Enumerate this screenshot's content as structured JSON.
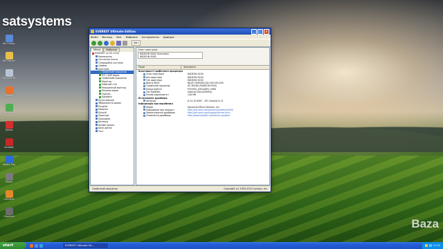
{
  "brand": "satsystems",
  "watermark": "Baza",
  "desktop_icons": [
    {
      "label": "My Computer",
      "color": "#5b8ad6"
    },
    {
      "label": "My Documents",
      "color": "#e7c04a"
    },
    {
      "label": "Recycle Bin",
      "color": "#b8c5d6"
    },
    {
      "label": "Firefox",
      "color": "#e5732b"
    },
    {
      "label": "Network",
      "color": "#4caf50"
    },
    {
      "label": "Opera",
      "color": "#d32f2f"
    },
    {
      "label": "Acrobat",
      "color": "#c62828"
    },
    {
      "label": "Media Player",
      "color": "#2b6cd6"
    },
    {
      "label": "Player",
      "color": "#7a7a7a"
    },
    {
      "label": "Uninstall",
      "color": "#e08a2b"
    },
    {
      "label": "Shortcut",
      "color": "#6d6d6d"
    }
  ],
  "window": {
    "title": "EVEREST Ultimate Edition",
    "menu": [
      "Файл",
      "Вигляд",
      "Звіт",
      "Вибране",
      "Інструменти",
      "Довідка"
    ],
    "report_button": "Звіт",
    "tabs": [
      "Меню",
      "Вибране"
    ],
    "tree": [
      {
        "label": "EVEREST v2.55.1316",
        "level": 0,
        "color": "#c0392b"
      },
      {
        "label": "Компьютер",
        "level": 1,
        "color": "#4a78c2"
      },
      {
        "label": "Системна плата",
        "level": 1,
        "color": "#4a78c2"
      },
      {
        "label": "Операційна система",
        "level": 1,
        "color": "#4a78c2"
      },
      {
        "label": "Сервер",
        "level": 1,
        "color": "#4a78c2"
      },
      {
        "label": "Дисплей",
        "level": 1,
        "color": "#4a78c2"
      },
      {
        "label": "Графічний процесор",
        "level": 2,
        "color": "#3d9a3d",
        "selected": true
      },
      {
        "label": "PCI / AGP відео",
        "level": 2,
        "color": "#3d9a3d"
      },
      {
        "label": "Графічний процесор",
        "level": 2,
        "color": "#3d9a3d"
      },
      {
        "label": "Монітор",
        "level": 2,
        "color": "#3d9a3d"
      },
      {
        "label": "Робочий стіл",
        "level": 2,
        "color": "#3d9a3d"
      },
      {
        "label": "Множинний монітор",
        "level": 2,
        "color": "#3d9a3d"
      },
      {
        "label": "Режими відео",
        "level": 2,
        "color": "#3d9a3d"
      },
      {
        "label": "OpenGL",
        "level": 2,
        "color": "#3d9a3d"
      },
      {
        "label": "Шрифти",
        "level": 2,
        "color": "#3d9a3d"
      },
      {
        "label": "Мультимедіа",
        "level": 1,
        "color": "#4a78c2"
      },
      {
        "label": "Збереження даних",
        "level": 1,
        "color": "#4a78c2"
      },
      {
        "label": "Розділи",
        "level": 1,
        "color": "#4a78c2"
      },
      {
        "label": "Мережа",
        "level": 1,
        "color": "#4a78c2"
      },
      {
        "label": "DirectX",
        "level": 1,
        "color": "#4a78c2"
      },
      {
        "label": "Пристрої",
        "level": 1,
        "color": "#4a78c2"
      },
      {
        "label": "Програми",
        "level": 1,
        "color": "#4a78c2"
      },
      {
        "label": "Безпека",
        "level": 1,
        "color": "#4a78c2"
      },
      {
        "label": "Конфігурація",
        "level": 1,
        "color": "#4a78c2"
      },
      {
        "label": "База даних",
        "level": 1,
        "color": "#4a78c2"
      },
      {
        "label": "Тест",
        "level": 1,
        "color": "#4a78c2"
      }
    ],
    "device_box_label": "Опис пристрою",
    "devices": [
      "RADEON 9200 Secondary",
      "RADEON 9200"
    ],
    "columns": [
      "Поле",
      "Значення"
    ],
    "rows": [
      {
        "field": "Властивості графічного процесора",
        "value": "",
        "group": true
      },
      {
        "field": "Опис пристрою",
        "value": "RADEON 9200"
      },
      {
        "field": "Ім'я адаптера",
        "value": "RADEON 9200"
      },
      {
        "field": "Тип адаптера",
        "value": "RADEON 9200"
      },
      {
        "field": "Версія BIOS",
        "value": "BK-ATI VER008.018.018.000.000"
      },
      {
        "field": "Графічний процесор",
        "value": "ATI RV280 (RADEON 9200)"
      },
      {
        "field": "Апаратний ID",
        "value": "PCI\\VEN_1002&DEV_5964"
      },
      {
        "field": "Тип RAMDAC",
        "value": "Internal DAC(400MHz)"
      },
      {
        "field": "Розмір відеопам'яті",
        "value": "128 MB"
      },
      {
        "field": "Встановлені драйвери",
        "value": "",
        "group": true
      },
      {
        "field": "ati2dvag",
        "value": "6.14.10.6567 - ATI Catalyst 6.12"
      },
      {
        "field": "Інформація про виробника",
        "value": "",
        "group": true
      },
      {
        "field": "Фірма",
        "value": "Advanced Micro Devices, Inc.",
        "link": false
      },
      {
        "field": "Інформація про продукт",
        "value": "http://ati.amd.com/products/radeon9200/",
        "link": true
      },
      {
        "field": "Завантаження драйвера",
        "value": "http://ati.amd.com/support/driver.html",
        "link": true
      },
      {
        "field": "Оновлення драйвера",
        "value": "http://www.aida64.com/driver-updates",
        "link": true
      }
    ],
    "status_left": "Графічний процесор",
    "status_right": "Copyright (c) 2003-2010 Lavalys, Inc."
  },
  "taskbar": {
    "start": "start",
    "task": "EVEREST Ultimate Ed...",
    "clock": "11:02"
  }
}
